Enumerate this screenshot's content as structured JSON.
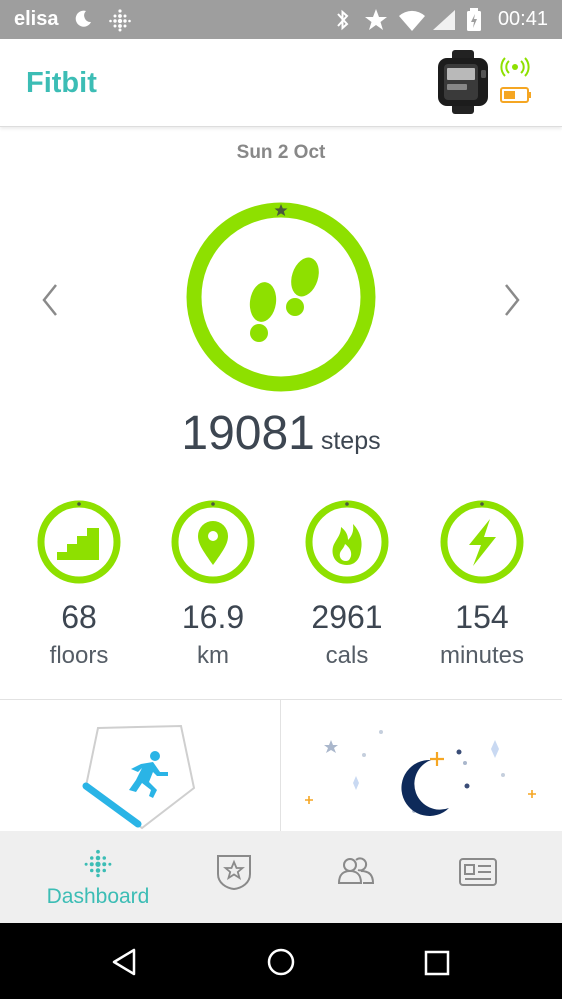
{
  "status_bar": {
    "carrier": "elisa",
    "time": "00:41"
  },
  "app_bar": {
    "title": "Fitbit"
  },
  "date": "Sun 2 Oct",
  "steps": {
    "value": "19081",
    "unit": "steps"
  },
  "stats": [
    {
      "value": "68",
      "unit": "floors",
      "icon": "stairs-icon"
    },
    {
      "value": "16.9",
      "unit": "km",
      "icon": "location-pin-icon"
    },
    {
      "value": "2961",
      "unit": "cals",
      "icon": "flame-icon"
    },
    {
      "value": "154",
      "unit": "minutes",
      "icon": "lightning-icon"
    }
  ],
  "colors": {
    "accent": "#3cbdb5",
    "ring": "#8ee000",
    "text": "#3d4651",
    "battery": "#f5a623",
    "moon": "#0e2a5a",
    "runner": "#2ab4e6"
  },
  "bottom_nav": {
    "items": [
      {
        "label": "Dashboard",
        "icon": "dashboard-icon",
        "active": true
      },
      {
        "label": "",
        "icon": "challenges-icon"
      },
      {
        "label": "",
        "icon": "friends-icon"
      },
      {
        "label": "",
        "icon": "account-icon"
      }
    ]
  }
}
